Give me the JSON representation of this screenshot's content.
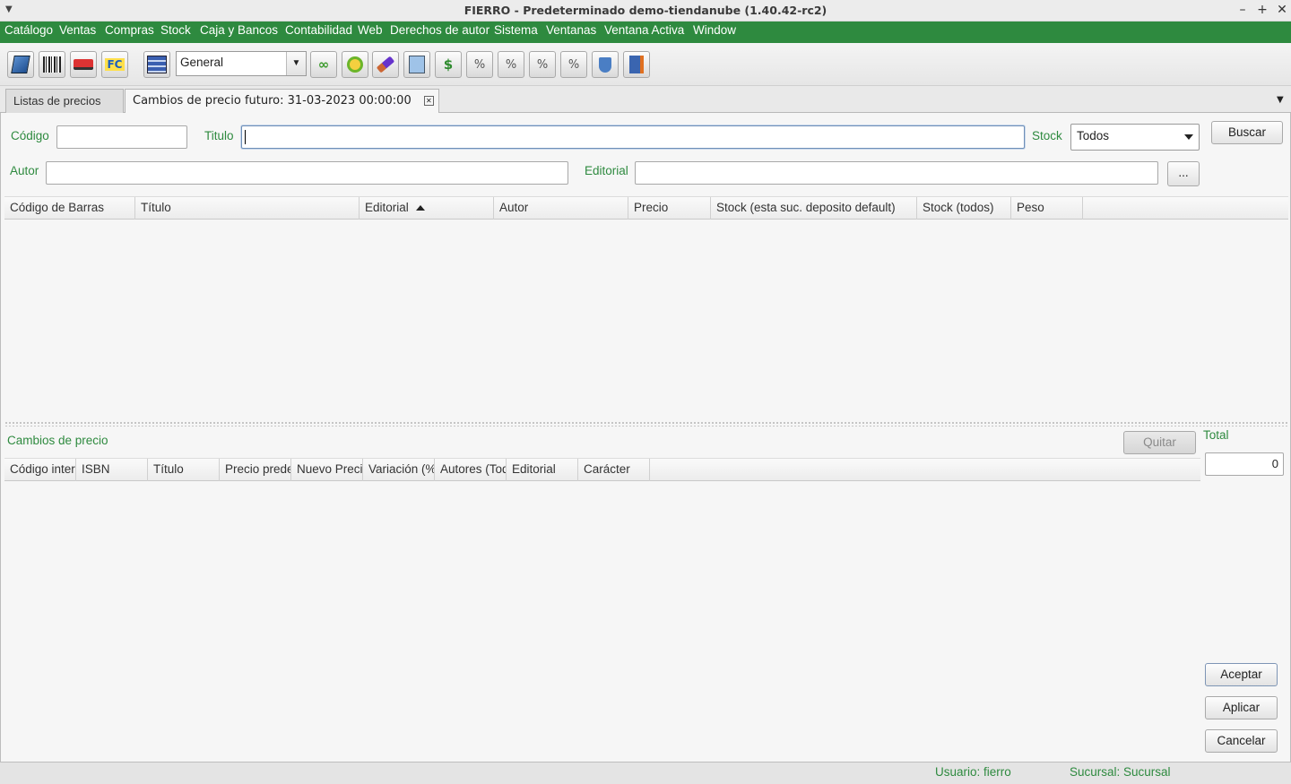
{
  "window": {
    "title": "FIERRO - Predeterminado demo-tiendanube (1.40.42-rc2)",
    "controls": [
      "–",
      "+",
      "✕"
    ]
  },
  "menu": [
    "Catálogo",
    "Ventas",
    "Compras",
    "Stock",
    "Caja y Bancos",
    "Contabilidad",
    "Web",
    "Derechos de autor",
    "Sistema",
    "Ventanas",
    "Ventana Activa",
    "Window"
  ],
  "toolbar": {
    "selector_value": "General",
    "icons": [
      "book-icon",
      "barcode-icon",
      "truck-icon",
      "invoice-fc-icon",
      "stack-icon",
      "links-icon",
      "target-icon",
      "eraser-icon",
      "search-doc-icon",
      "money-edit-icon",
      "percent-edit-icon",
      "percent-edit-icon",
      "percent-edit-icon",
      "percent-edit-icon",
      "shield-icon",
      "exit-icon"
    ]
  },
  "tabs": [
    {
      "label": "Listas de precios",
      "active": false
    },
    {
      "label": "Cambios de precio futuro: 31-03-2023 00:00:00",
      "active": true
    }
  ],
  "search": {
    "codigo_label": "Código",
    "codigo_value": "",
    "titulo_label": "Titulo",
    "titulo_value": "",
    "stock_label": "Stock",
    "stock_value": "Todos",
    "buscar_label": "Buscar",
    "autor_label": "Autor",
    "autor_value": "",
    "editorial_label": "Editorial",
    "editorial_value": "",
    "more_label": "..."
  },
  "results_table": {
    "columns": [
      "Código de Barras",
      "Título",
      "Editorial",
      "Autor",
      "Precio",
      "Stock (esta suc. deposito default)",
      "Stock (todos)",
      "Peso"
    ],
    "sorted_column": "Editorial",
    "rows": []
  },
  "changes": {
    "title": "Cambios de precio",
    "quitar_label": "Quitar",
    "total_label": "Total",
    "total_value": "0",
    "columns": [
      "Código interr",
      "ISBN",
      "Título",
      "Precio prede",
      "Nuevo Preci",
      "Variación (%",
      "Autores (Tod",
      "Editorial",
      "Carácter"
    ],
    "rows": []
  },
  "actions": {
    "aceptar": "Aceptar",
    "aplicar": "Aplicar",
    "cancelar": "Cancelar"
  },
  "status": {
    "usuario": "Usuario: fierro",
    "sucursal": "Sucursal: Sucursal"
  },
  "colors": {
    "accent_green": "#2e8a3f"
  }
}
